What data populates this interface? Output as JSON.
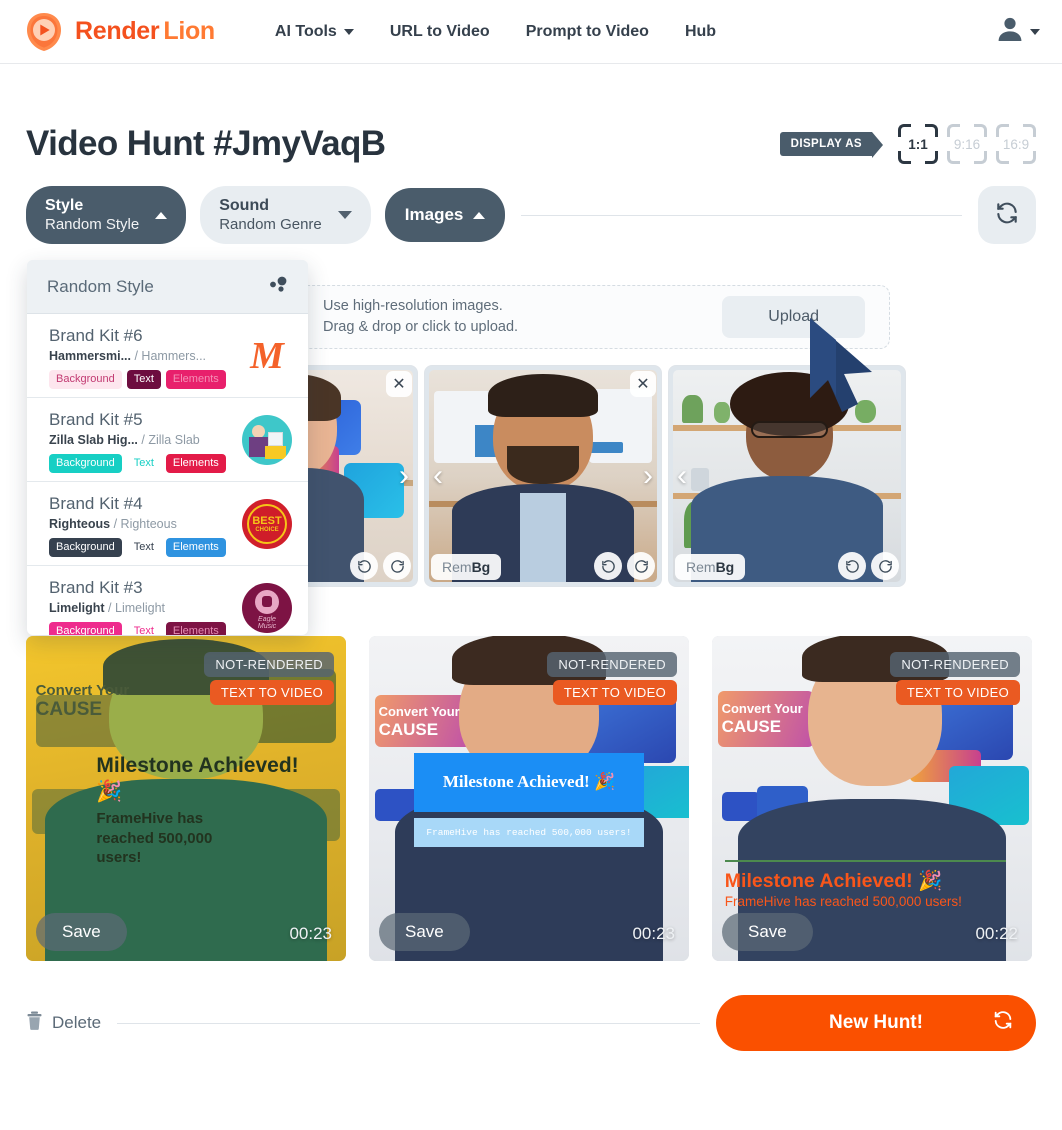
{
  "header": {
    "logo_text_1": "Render",
    "logo_text_2": "Lion",
    "logo_icon": "lion-play-logo",
    "nav": [
      {
        "label": "AI Tools",
        "has_caret": true
      },
      {
        "label": "URL to Video",
        "has_caret": false
      },
      {
        "label": "Prompt to Video",
        "has_caret": false
      },
      {
        "label": "Hub",
        "has_caret": false
      }
    ],
    "account_icon": "user-avatar-icon"
  },
  "page": {
    "title": "Video Hunt #JmyVaqB",
    "display_as_label": "DISPLAY AS",
    "ratios": [
      {
        "label": "1:1",
        "active": true
      },
      {
        "label": "9:16",
        "active": false
      },
      {
        "label": "16:9",
        "active": false
      }
    ]
  },
  "controls": {
    "style": {
      "title": "Style",
      "value": "Random Style",
      "state": "open",
      "arrow": "caret-up"
    },
    "sound": {
      "title": "Sound",
      "value": "Random Genre",
      "state": "closed",
      "arrow": "caret-down"
    },
    "images": {
      "label": "Images",
      "state": "open",
      "arrow": "caret-up"
    },
    "refresh_icon": "refresh-icon"
  },
  "style_dropdown": {
    "header": {
      "label": "Random Style",
      "icon": "random-dots-icon"
    },
    "items": [
      {
        "name": "Brand Kit #6",
        "font_primary": "Hammersmi...",
        "font_secondary": "Hammers...",
        "chips": [
          {
            "label": "Background",
            "bg": "#fde6ee",
            "fg": "#c23a72"
          },
          {
            "label": "Text",
            "bg": "#6d0d3f",
            "fg": "#ffffff"
          },
          {
            "label": "Elements",
            "bg": "#e8206c",
            "fg": "#f58fb6"
          }
        ],
        "thumb": "monogram-m-logo",
        "thumb_bg": "#ffffff"
      },
      {
        "name": "Brand Kit #5",
        "font_primary": "Zilla Slab Hig...",
        "font_secondary": "Zilla Slab",
        "chips": [
          {
            "label": "Background",
            "bg": "#17cfc4",
            "fg": "#ffffff"
          },
          {
            "label": "Text",
            "bg": "#ffffff",
            "fg": "#17cfc4"
          },
          {
            "label": "Elements",
            "bg": "#e31b48",
            "fg": "#ffffff"
          }
        ],
        "thumb": "desk-worker-illustration",
        "thumb_bg": "#3ec7c9"
      },
      {
        "name": "Brand Kit #4",
        "font_primary": "Righteous",
        "font_secondary": "Righteous",
        "chips": [
          {
            "label": "Background",
            "bg": "#36414f",
            "fg": "#ffffff"
          },
          {
            "label": "Text",
            "bg": "#ffffff",
            "fg": "#36414f"
          },
          {
            "label": "Elements",
            "bg": "#2f93e0",
            "fg": "#ffffff"
          }
        ],
        "thumb": "best-choice-badge",
        "thumb_bg": "#d01f2b"
      },
      {
        "name": "Brand Kit #3",
        "font_primary": "Limelight",
        "font_secondary": "Limelight",
        "chips": [
          {
            "label": "Background",
            "bg": "#ee2b8d",
            "fg": "#ffffff"
          },
          {
            "label": "Text",
            "bg": "#ffffff",
            "fg": "#ee2b8d"
          },
          {
            "label": "Elements",
            "bg": "#7d1344",
            "fg": "#e58cb4"
          }
        ],
        "thumb": "eagle-music-owl-logo",
        "thumb_bg": "#7d1344"
      }
    ]
  },
  "upload": {
    "line1": "Use high-resolution images.",
    "line2": "Drag & drop or click to upload.",
    "button": "Upload"
  },
  "thumbnails": {
    "close_icon": "close-icon",
    "prev_icon": "chevron-left-icon",
    "next_icon": "chevron-right-icon",
    "rembg_prefix": "Rem",
    "rembg_suffix": "Bg",
    "rotate_left_icon": "rotate-left-icon",
    "rotate_right_icon": "rotate-right-icon",
    "items": [
      {
        "alt": "man-in-navy-shirt-office",
        "clipped": true
      },
      {
        "alt": "bearded-man-in-blue-suit",
        "clipped": false
      },
      {
        "alt": "woman-with-glasses-blue-shirt",
        "clipped": false
      }
    ]
  },
  "video_cards": [
    {
      "status_badge": "NOT-RENDERED",
      "type_badge": "TEXT TO VIDEO",
      "save_label": "Save",
      "duration": "00:23",
      "overlay_title": "Milestone Achieved!",
      "overlay_body": "FrameHive has reached 500,000 users!",
      "overlay_emoji": "🎉",
      "bg_caption_line1": "Convert Your",
      "bg_caption_line2": "CAUSE",
      "style": "duotone-yellow-green"
    },
    {
      "status_badge": "NOT-RENDERED",
      "type_badge": "TEXT TO VIDEO",
      "save_label": "Save",
      "duration": "00:23",
      "overlay_title": "Milestone Achieved!",
      "overlay_body": "FrameHive has reached 500,000 users!",
      "overlay_emoji": "🎉",
      "bg_caption_line1": "Convert Your",
      "bg_caption_line2": "CAUSE",
      "style": "blue-banner"
    },
    {
      "status_badge": "NOT-RENDERED",
      "type_badge": "TEXT TO VIDEO",
      "save_label": "Save",
      "duration": "00:22",
      "overlay_title": "Milestone Achieved!",
      "overlay_body": "FrameHive has reached 500,000 users!",
      "overlay_emoji": "🎉",
      "bg_caption_line1": "Convert Your",
      "bg_caption_line2": "CAUSE",
      "style": "orange-bottom-text"
    }
  ],
  "footer": {
    "delete_label": "Delete",
    "delete_icon": "trash-icon",
    "new_hunt_label": "New Hunt!",
    "new_hunt_icon": "refresh-icon",
    "accent_color": "#fa5000"
  },
  "cursor": {
    "icon": "mouse-pointer-cursor"
  }
}
